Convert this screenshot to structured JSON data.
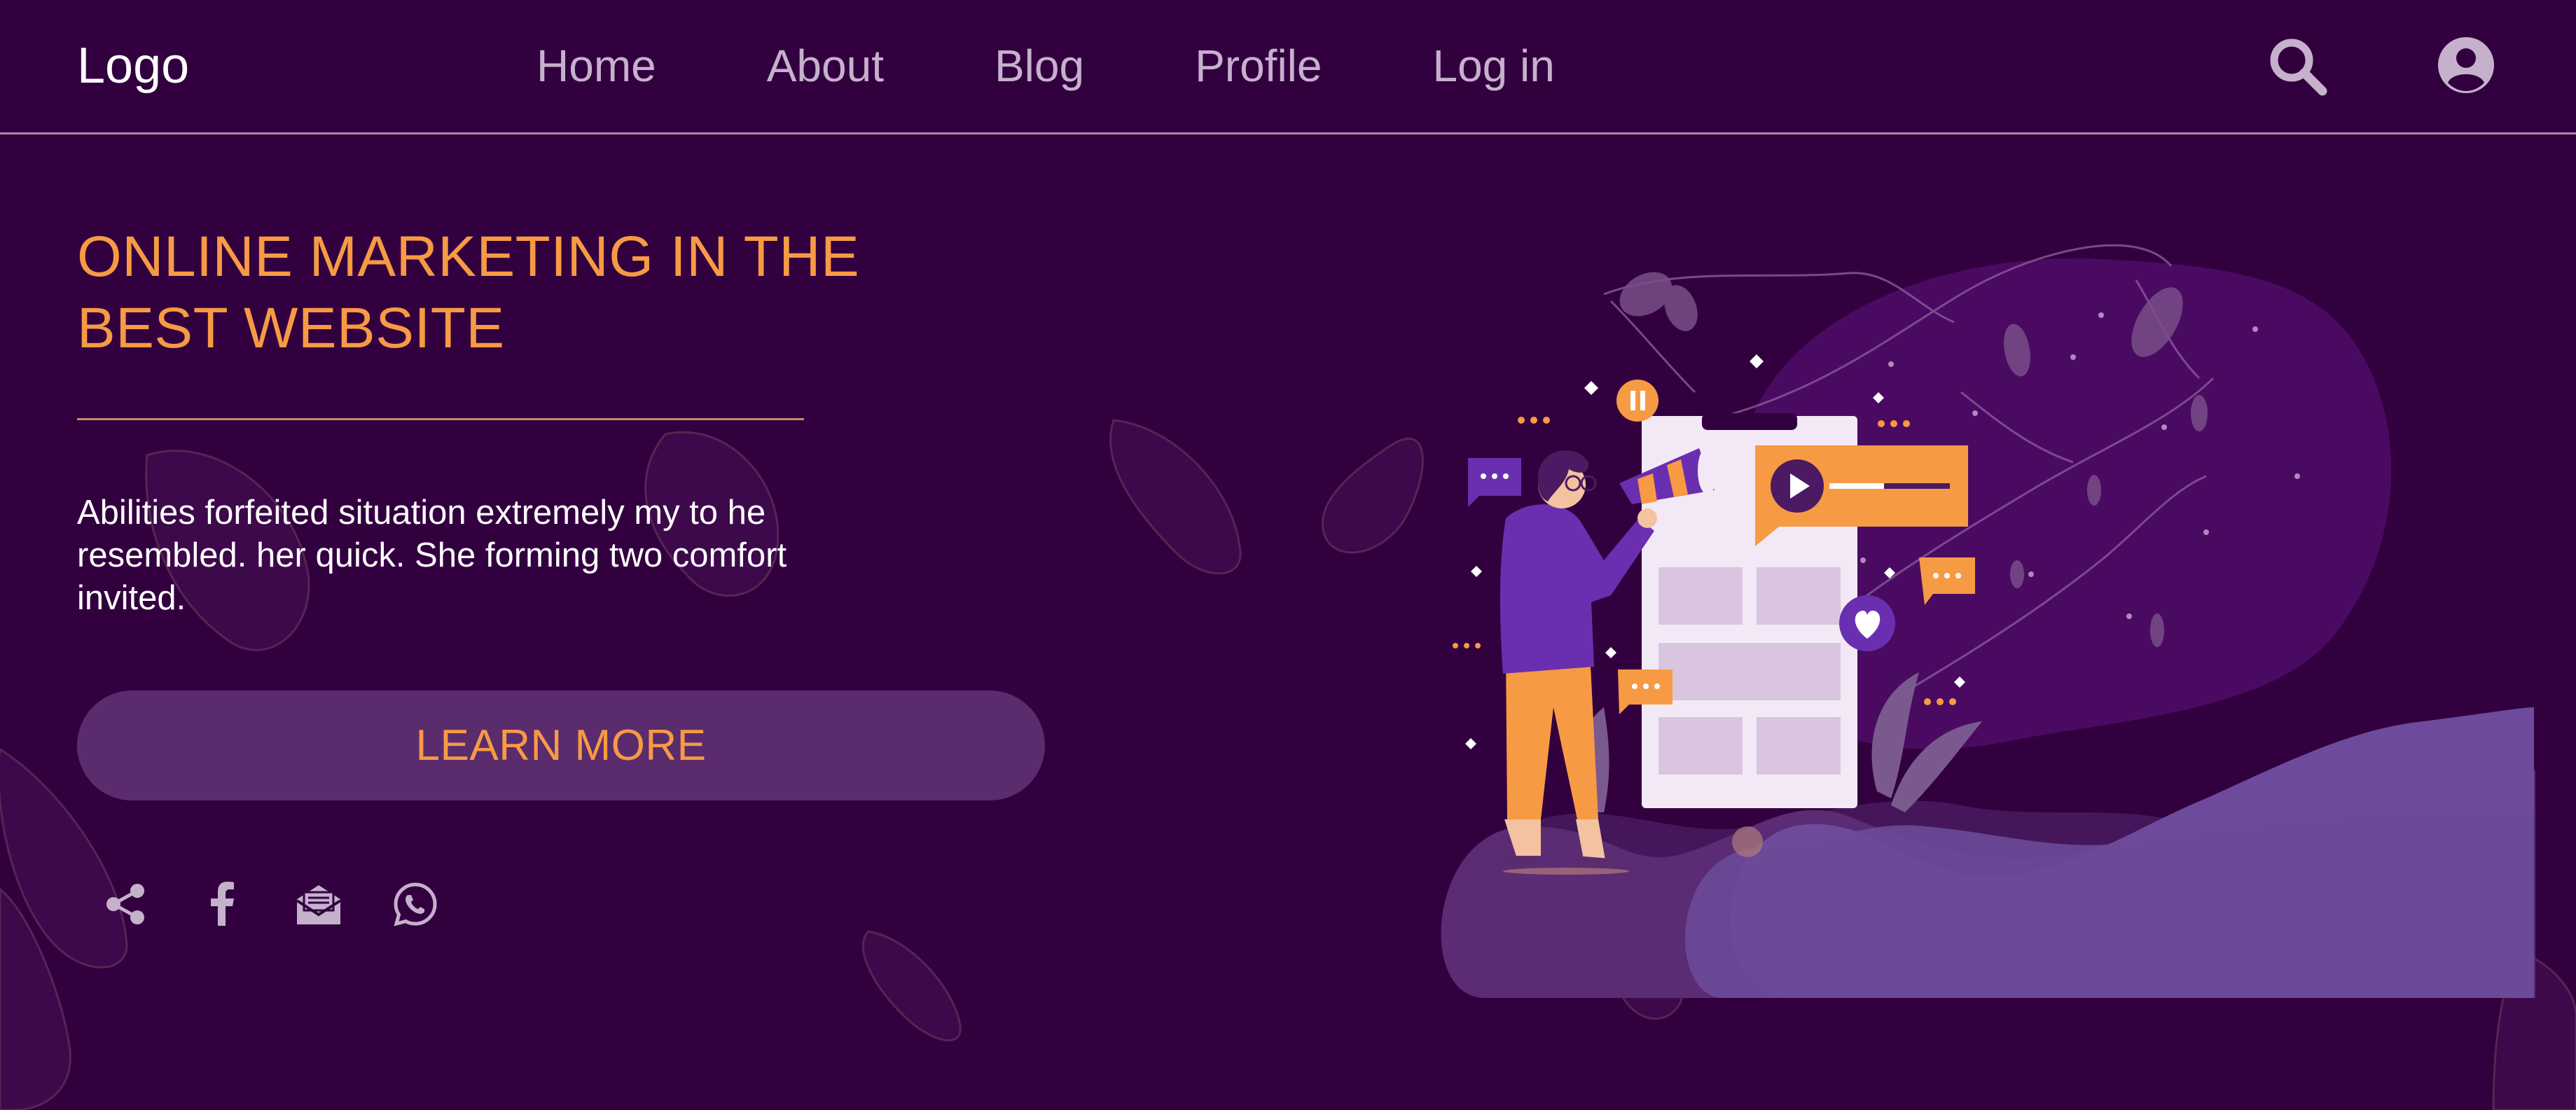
{
  "header": {
    "logo": "Logo",
    "nav": [
      "Home",
      "About",
      "Blog",
      "Profile",
      "Log in"
    ],
    "icons": {
      "search": "search-icon",
      "account": "account-circle-icon"
    }
  },
  "hero": {
    "title": "ONLINE MARKETING IN THE BEST WEBSITE",
    "description": "Abilities forfeited situation extremely my to he resembled. her quick. She forming two comfort invited.",
    "cta_label": "LEARN MORE"
  },
  "social": [
    {
      "icon": "share-icon"
    },
    {
      "icon": "facebook-icon"
    },
    {
      "icon": "email-open-icon"
    },
    {
      "icon": "whatsapp-icon"
    }
  ],
  "colors": {
    "background": "#32003f",
    "accent": "#f79a44",
    "button_bg": "#5a2c6e",
    "nav_text": "#c6b1cc",
    "illustration_purple": "#4a0a5e"
  }
}
